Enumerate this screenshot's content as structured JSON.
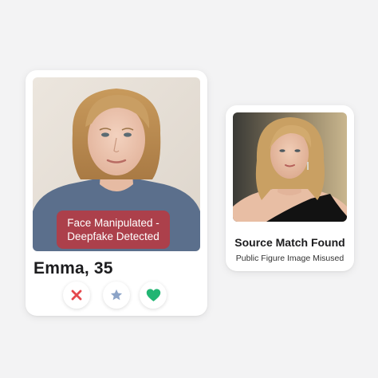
{
  "profile": {
    "name_age": "Emma, 35",
    "alert_line1": "Face Manipulated -",
    "alert_line2": "Deepfake Detected"
  },
  "actions": [
    {
      "icon": "x-icon",
      "color": "#e5484d"
    },
    {
      "icon": "star-icon",
      "color": "#8ba3c7"
    },
    {
      "icon": "heart-icon",
      "color": "#22b573"
    }
  ],
  "match": {
    "title": "Source Match Found",
    "subtitle": "Public Figure Image Misused"
  },
  "colors": {
    "alert_bg": "#b93840",
    "background": "#f3f3f4"
  }
}
